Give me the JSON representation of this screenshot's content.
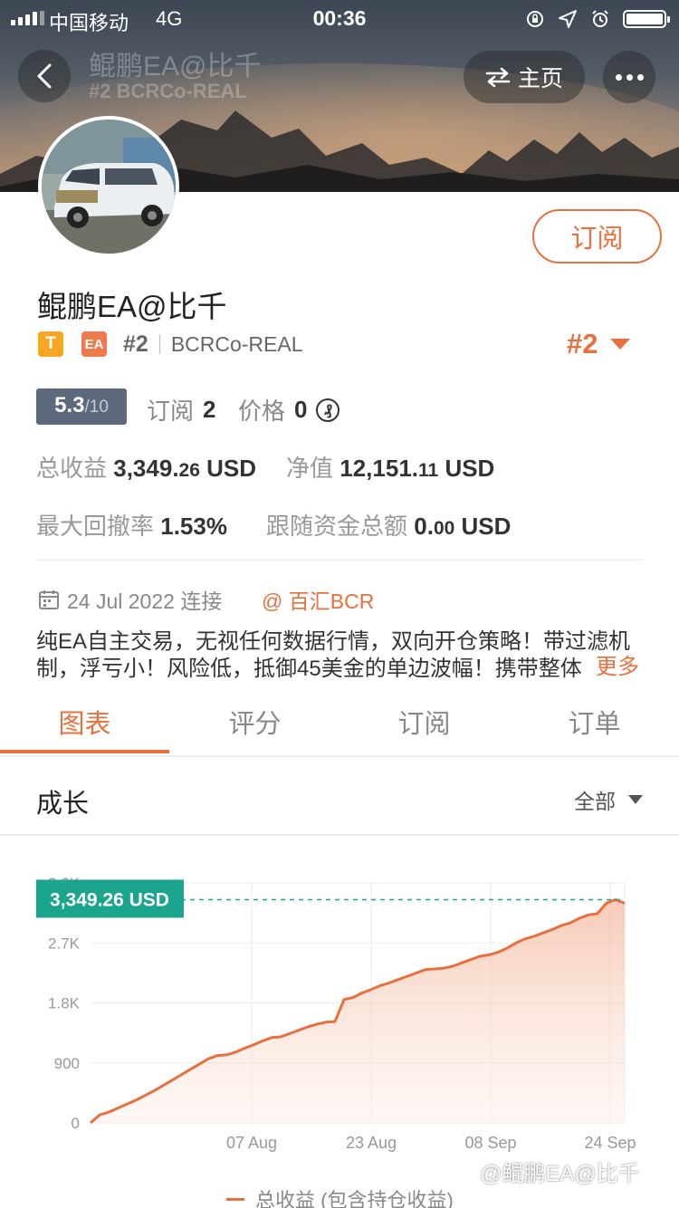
{
  "statusbar": {
    "carrier": "中国移动",
    "network": "4G",
    "time": "00:36"
  },
  "header": {
    "title": "鲲鹏EA@比千",
    "subtitle": "#2 BCRCo-REAL",
    "home_label": "主页"
  },
  "profile": {
    "subscribe_label": "订阅",
    "name": "鲲鹏EA@比千",
    "tag_t": "T",
    "tag_ea": "EA",
    "rank": "#2",
    "server": "BCRCo-REAL",
    "rank_display": "#2"
  },
  "stats": {
    "score": "5.3",
    "score_max": "/10",
    "subs_label": "订阅",
    "subs_value": "2",
    "price_label": "价格",
    "price_value": "0",
    "currency_icon": "₰"
  },
  "metrics": {
    "profit_label": "总收益",
    "profit_int": "3,349.",
    "profit_dec": "26",
    "profit_unit": "USD",
    "equity_label": "净值",
    "equity_int": "12,151.",
    "equity_dec": "11",
    "equity_unit": "USD",
    "dd_label": "最大回撤率",
    "dd_value": "1.53%",
    "follow_label": "跟随资金总额",
    "follow_int": "0.",
    "follow_dec": "00",
    "follow_unit": "USD"
  },
  "info": {
    "joined": "24 Jul 2022 连接",
    "broker": "@ 百汇BCR",
    "description": "纯EA自主交易，无视任何数据行情，双向开仓策略！带过滤机制，浮亏小！风险低，抵御45美金的单边波幅！携带整体",
    "more": "更多"
  },
  "tabs": [
    "图表",
    "评分",
    "订阅",
    "订单"
  ],
  "section": {
    "title": "成长",
    "range": "全部"
  },
  "chart_data": {
    "type": "area",
    "series": [
      {
        "name": "总收益 (包含持仓收益)",
        "color": "#e8703e"
      }
    ],
    "x_ticks": [
      "07 Aug",
      "23 Aug",
      "08 Sep",
      "24 Sep"
    ],
    "y_ticks": [
      "0",
      "900",
      "1.8K",
      "2.7K",
      "3.6K"
    ],
    "ylim": [
      0,
      3600
    ],
    "current_label": "3,349.26 USD",
    "current_value": 3349.26,
    "values": [
      0,
      120,
      160,
      220,
      280,
      340,
      410,
      480,
      560,
      640,
      720,
      800,
      880,
      960,
      1010,
      1020,
      1060,
      1120,
      1170,
      1230,
      1280,
      1290,
      1340,
      1390,
      1440,
      1480,
      1510,
      1520,
      1850,
      1880,
      1950,
      2000,
      2060,
      2100,
      2150,
      2200,
      2250,
      2300,
      2310,
      2320,
      2350,
      2400,
      2450,
      2500,
      2520,
      2560,
      2620,
      2700,
      2760,
      2800,
      2850,
      2900,
      2960,
      3000,
      3070,
      3120,
      3140,
      3300,
      3349.26
    ],
    "legend": "总收益 (包含持仓收益)"
  },
  "watermark": "@鲲鹏EA@比千"
}
